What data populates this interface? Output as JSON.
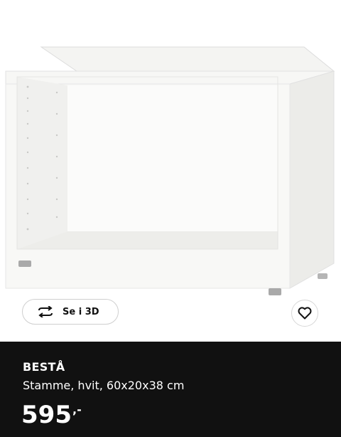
{
  "product": {
    "name": "BESTÅ",
    "description": "Stamme, hvit, 60x20x38 cm",
    "price": "595",
    "price_suffix": ",-"
  },
  "view3d": {
    "label": "Se i 3D",
    "icon": "rotate-3d-icon"
  },
  "favorite": {
    "icon": "heart-icon"
  },
  "colors": {
    "info_bg": "#111111",
    "info_text": "#ffffff"
  }
}
